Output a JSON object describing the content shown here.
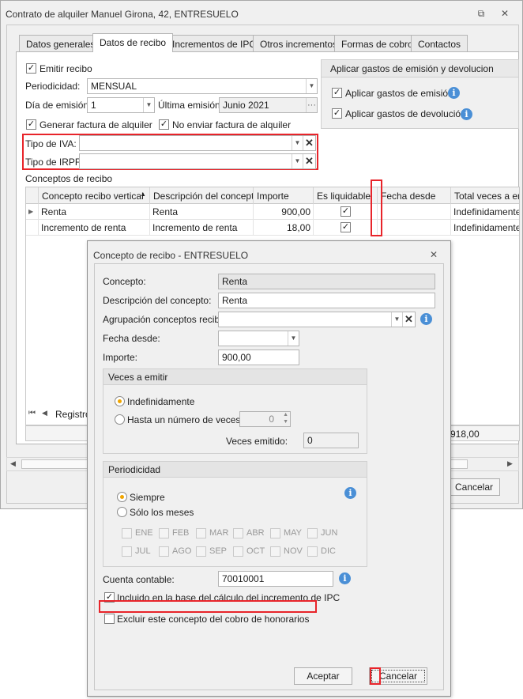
{
  "window": {
    "title": "Contrato de alquiler Manuel Girona, 42, ENTRESUELO",
    "restore_icon": "⧉",
    "close_icon": "✕"
  },
  "tabs": [
    {
      "label": "Datos generales"
    },
    {
      "label": "Datos de recibo"
    },
    {
      "label": "Incrementos de IPC"
    },
    {
      "label": "Otros incrementos"
    },
    {
      "label": "Formas de cobro"
    },
    {
      "label": "Contactos"
    }
  ],
  "recibo": {
    "emitir_label": "Emitir recibo",
    "periodicidad_label": "Periodicidad:",
    "periodicidad_value": "MENSUAL",
    "dia_label": "Día de emisión:",
    "dia_value": "1",
    "ultima_label": "Última emisión:",
    "ultima_value": "Junio 2021",
    "generar_label": "Generar factura de alquiler",
    "no_enviar_label": "No enviar factura de alquiler",
    "iva_label": "Tipo de IVA:",
    "iva_value": "",
    "irpf_label": "Tipo de IRPF:",
    "irpf_value": "",
    "gastos_title": "Aplicar gastos de emisión y devolucion",
    "gastos_emision_label": "Aplicar gastos de emisión",
    "gastos_devolucion_label": "Aplicar gastos de devolución",
    "conceptos_label": "Conceptos de recibo"
  },
  "grid": {
    "columns": [
      "Concepto recibo vertical",
      "Descripción del concepto",
      "Importe",
      "Es liquidable",
      "Fecha desde",
      "Total veces a em"
    ],
    "rows": [
      {
        "concepto": "Renta",
        "descripcion": "Renta",
        "importe": "900,00",
        "liquidable": "✓",
        "fecha": "",
        "total": "Indefinidamente"
      },
      {
        "concepto": "Incremento de renta",
        "descripcion": "Incremento de renta",
        "importe": "18,00",
        "liquidable": "✓",
        "fecha": "",
        "total": "Indefinidamente"
      }
    ],
    "nav_label": "Registro",
    "total_sum": "918,00",
    "cancel_label": "Cancelar"
  },
  "dialog": {
    "title": "Concepto de recibo - ENTRESUELO",
    "close_icon": "✕",
    "concepto_label": "Concepto:",
    "concepto_value": "Renta",
    "descripcion_label": "Descripción del concepto:",
    "descripcion_value": "Renta",
    "agrupacion_label": "Agrupación conceptos recibo:",
    "agrupacion_value": "",
    "fecha_label": "Fecha desde:",
    "fecha_value": "",
    "importe_label": "Importe:",
    "importe_value": "900,00",
    "veces_title": "Veces a emitir",
    "indefinidamente_label": "Indefinidamente",
    "hasta_label": "Hasta un número de veces",
    "hasta_value": "0",
    "veces_emitido_label": "Veces emitido:",
    "veces_emitido_value": "0",
    "periodicidad_title": "Periodicidad",
    "siempre_label": "Siempre",
    "solo_label": "Sólo los meses",
    "months": [
      "ENE",
      "FEB",
      "MAR",
      "ABR",
      "MAY",
      "JUN",
      "JUL",
      "AGO",
      "SEP",
      "OCT",
      "NOV",
      "DIC"
    ],
    "cuenta_label": "Cuenta contable:",
    "cuenta_value": "70010001",
    "incluido_label": "Incluido en la base del cálculo del incremento de IPC",
    "excluir_label": "Excluir este concepto del cobro de honorarios",
    "aceptar_label": "Aceptar",
    "cancelar_label": "Cancelar"
  },
  "colors": {
    "accent_red": "#e8242a",
    "info_blue": "#4a8fd6",
    "radio_orange": "#f0a500"
  }
}
